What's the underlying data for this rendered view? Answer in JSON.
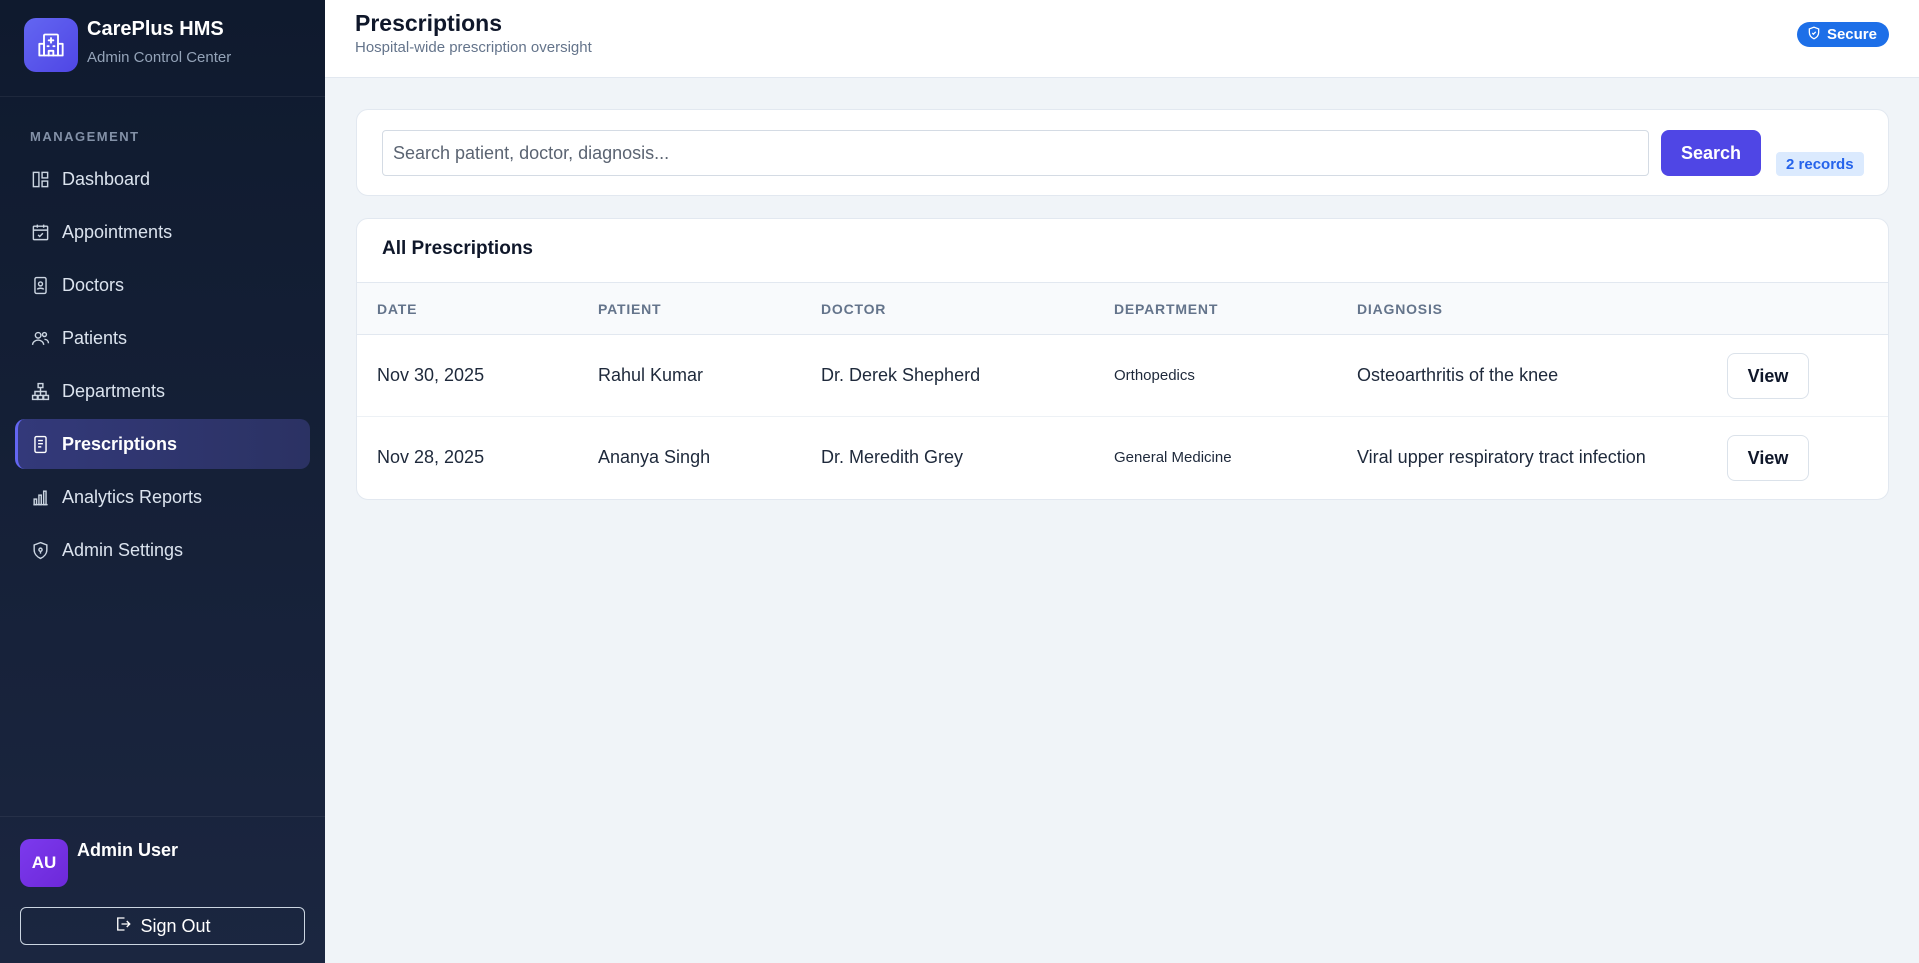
{
  "brand": {
    "title": "CarePlus HMS",
    "subtitle": "Admin Control Center"
  },
  "sidebar": {
    "section_label": "MANAGEMENT",
    "items": [
      {
        "label": "Dashboard",
        "icon": "dashboard-icon",
        "active": false
      },
      {
        "label": "Appointments",
        "icon": "calendar-check-icon",
        "active": false
      },
      {
        "label": "Doctors",
        "icon": "doctor-badge-icon",
        "active": false
      },
      {
        "label": "Patients",
        "icon": "users-icon",
        "active": false
      },
      {
        "label": "Departments",
        "icon": "hierarchy-icon",
        "active": false
      },
      {
        "label": "Prescriptions",
        "icon": "prescription-icon",
        "active": true
      },
      {
        "label": "Analytics Reports",
        "icon": "bar-chart-icon",
        "active": false
      },
      {
        "label": "Admin Settings",
        "icon": "shield-icon",
        "active": false
      }
    ]
  },
  "user": {
    "initials": "AU",
    "name": "Admin User",
    "signout_label": "Sign Out"
  },
  "header": {
    "title": "Prescriptions",
    "subtitle": "Hospital-wide prescription oversight",
    "badge": "Secure"
  },
  "search": {
    "placeholder": "Search patient, doctor, diagnosis...",
    "value": "",
    "button_label": "Search",
    "records": "2 records"
  },
  "table": {
    "title": "All Prescriptions",
    "columns": [
      "DATE",
      "PATIENT",
      "DOCTOR",
      "DEPARTMENT",
      "DIAGNOSIS"
    ],
    "rows": [
      {
        "date": "Nov 30, 2025",
        "patient": "Rahul Kumar",
        "doctor": "Dr. Derek Shepherd",
        "department": "Orthopedics",
        "diagnosis": "Osteoarthritis of the knee",
        "action": "View"
      },
      {
        "date": "Nov 28, 2025",
        "patient": "Ananya Singh",
        "doctor": "Dr. Meredith Grey",
        "department": "General Medicine",
        "diagnosis": "Viral upper respiratory tract infection",
        "action": "View"
      }
    ]
  },
  "colors": {
    "accent": "#4f46e5",
    "secure": "#1d6fe8",
    "sidebar_bg": "#0f1a2e"
  }
}
